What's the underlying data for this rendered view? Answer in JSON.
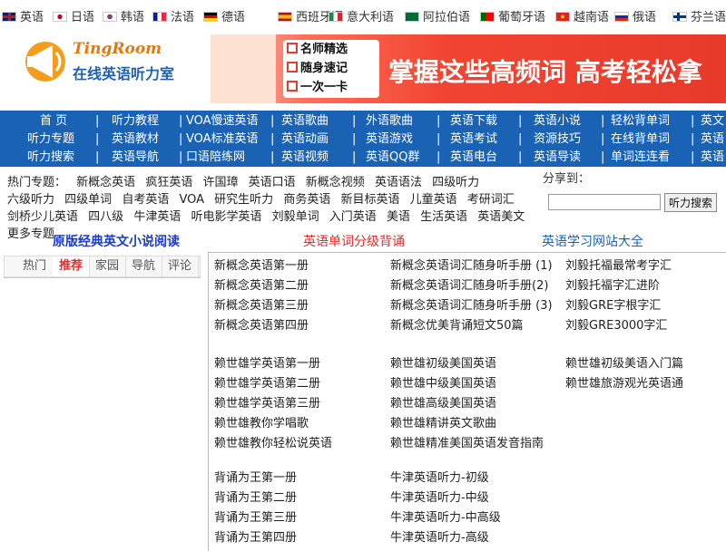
{
  "languages": [
    {
      "label": "英语",
      "flag": "uk"
    },
    {
      "label": "日语",
      "flag": "jp"
    },
    {
      "label": "韩语",
      "flag": "kr"
    },
    {
      "label": "法语",
      "flag": "fr"
    },
    {
      "label": "德语",
      "flag": "de"
    },
    {
      "label": "西班牙语",
      "flag": "es"
    },
    {
      "label": "意大利语",
      "flag": "it"
    },
    {
      "label": "阿拉伯语",
      "flag": "sa"
    },
    {
      "label": "葡萄牙语",
      "flag": "pt"
    },
    {
      "label": "越南语",
      "flag": "vn"
    },
    {
      "label": "俄语",
      "flag": "ru"
    },
    {
      "label": "芬兰语",
      "flag": "fi"
    }
  ],
  "logo": {
    "brand": "TingRoom",
    "tagline": "在线英语听力室"
  },
  "banner": {
    "points": [
      "名师精选",
      "随身速记",
      "一次一卡"
    ],
    "headline": "掌握这些高频词 高考轻松拿"
  },
  "nav_rows": [
    [
      "首 页",
      "听力教程",
      "VOA慢速英语",
      "英语歌曲",
      "外语歌曲",
      "英语下载",
      "英语小说",
      "轻松背单词",
      "英文"
    ],
    [
      "听力专题",
      "英语教材",
      "VOA标准英语",
      "英语动画",
      "英语游戏",
      "英语考试",
      "资源技巧",
      "在线背单词",
      "英语"
    ],
    [
      "听力搜索",
      "英语导航",
      "口语陪练网",
      "英语视频",
      "英语QQ群",
      "英语电台",
      "英语导读",
      "单词连连看",
      "英语"
    ]
  ],
  "hot_topics": [
    "热门专题：",
    "新概念英语",
    "疯狂英语",
    "许国璋",
    "英语口语",
    "新概念视频",
    "英语语法",
    "四级听力",
    "六级听力",
    "四级单词",
    "自考英语",
    "VOA",
    "研究生听力",
    "商务英语",
    "新目标英语",
    "儿童英语",
    "考研词汇",
    "剑桥少儿英语",
    "四八级",
    "牛津英语",
    "听电影学英语",
    "刘毅单词",
    "入门英语",
    "美语",
    "生活英语",
    "英语美文",
    "更多专题"
  ],
  "share_label": "分享到：",
  "search": {
    "value": "",
    "button": "听力搜索"
  },
  "sections": {
    "novels": "原版经典英文小说阅读",
    "vocab": "英语单词分级背诵",
    "sites": "英语学习网站大全"
  },
  "tabs": [
    {
      "label": "热门",
      "active": false
    },
    {
      "label": "推荐",
      "active": true
    },
    {
      "label": "家园",
      "active": false
    },
    {
      "label": "导航",
      "active": false
    },
    {
      "label": "评论",
      "active": false
    }
  ],
  "links": {
    "col1": [
      "新概念英语第一册",
      "新概念英语第二册",
      "新概念英语第三册",
      "新概念英语第四册",
      "",
      "赖世雄学英语第一册",
      "赖世雄学英语第二册",
      "赖世雄学英语第三册",
      "赖世雄教你学唱歌",
      "赖世雄教你轻松说英语",
      "",
      "背诵为王第一册",
      "背诵为王第二册",
      "背诵为王第三册",
      "背诵为王第四册"
    ],
    "col2": [
      "新概念英语词汇随身听手册 (1)",
      "新概念英语词汇随身听手册(2)",
      "新概念英语词汇随身听手册 (3)",
      "新概念优美背诵短文50篇",
      "",
      "赖世雄初级美国英语",
      "赖世雄中级美国英语",
      "赖世雄高级美国英语",
      "赖世雄精讲英文歌曲",
      "赖世雄精准美国英语发音指南",
      "",
      "牛津英语听力-初级",
      "牛津英语听力-中级",
      "牛津英语听力-中高级",
      "牛津英语听力-高级"
    ],
    "col3": [
      "刘毅托福最常考字汇",
      "刘毅托福字汇进阶",
      "刘毅GRE字根字汇",
      "刘毅GRE3000字汇",
      "",
      "赖世雄初级美语入门篇",
      "赖世雄旅游观光英语通",
      "",
      "",
      "",
      "",
      "",
      "",
      "",
      ""
    ]
  }
}
